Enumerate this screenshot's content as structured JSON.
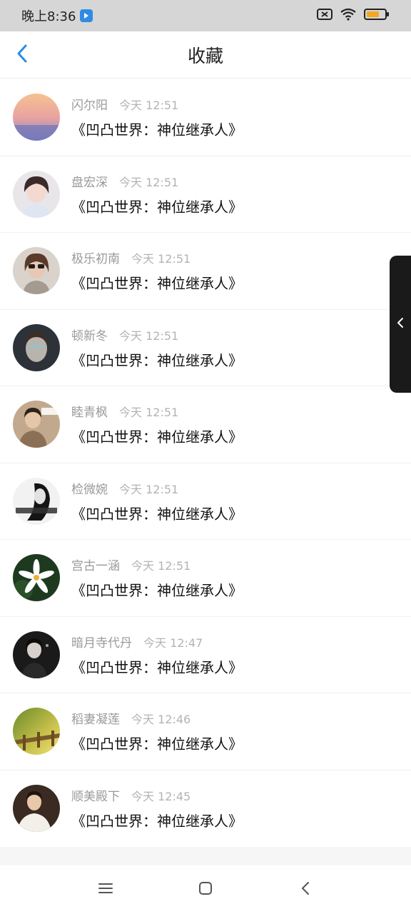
{
  "status_bar": {
    "time": "晚上8:36",
    "icons": [
      "notification-app-icon",
      "sim-off-icon",
      "wifi-icon",
      "battery-icon"
    ]
  },
  "header": {
    "title": "收藏",
    "back_icon": "chevron-left-icon"
  },
  "list": {
    "items": [
      {
        "username": "闪尔阳",
        "time": "今天 12:51",
        "title": "《凹凸世界：神位继承人》",
        "avatar": "sunset"
      },
      {
        "username": "盘宏深",
        "time": "今天 12:51",
        "title": "《凹凸世界：神位继承人》",
        "avatar": "girl-light"
      },
      {
        "username": "极乐初南",
        "time": "今天 12:51",
        "title": "《凹凸世界：神位继承人》",
        "avatar": "girl-sunglasses"
      },
      {
        "username": "顿新冬",
        "time": "今天 12:51",
        "title": "《凹凸世界：神位继承人》",
        "avatar": "dark-face"
      },
      {
        "username": "睦青枫",
        "time": "今天 12:51",
        "title": "《凹凸世界：神位继承人》",
        "avatar": "boy-beige"
      },
      {
        "username": "检微婉",
        "time": "今天 12:51",
        "title": "《凹凸世界：神位继承人》",
        "avatar": "bw-girl"
      },
      {
        "username": "宫古一涵",
        "time": "今天 12:51",
        "title": "《凹凸世界：神位继承人》",
        "avatar": "white-flower"
      },
      {
        "username": "暗月寺代丹",
        "time": "今天 12:47",
        "title": "《凹凸世界：神位继承人》",
        "avatar": "dark-portrait"
      },
      {
        "username": "稻妻凝莲",
        "time": "今天 12:46",
        "title": "《凹凸世界：神位继承人》",
        "avatar": "green-fence"
      },
      {
        "username": "顺美殿下",
        "time": "今天 12:45",
        "title": "《凹凸世界：神位继承人》",
        "avatar": "boy-white"
      }
    ]
  },
  "side_handle": {
    "icon": "chevron-left-icon"
  },
  "nav_bar": {
    "icons": [
      "menu-icon",
      "home-square-icon",
      "back-chevron-icon"
    ]
  }
}
